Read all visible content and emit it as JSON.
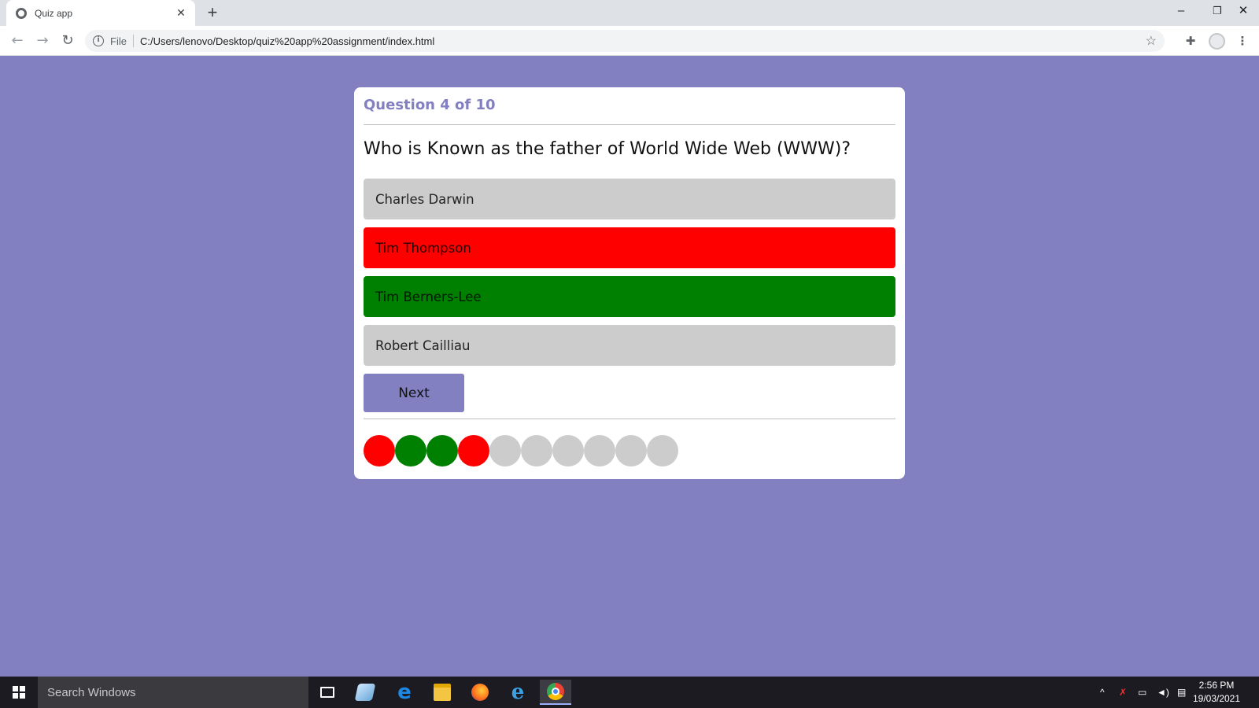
{
  "browser": {
    "tab_title": "Quiz app",
    "tab_close": "✕",
    "new_tab": "+",
    "scheme_label": "File",
    "url": "C:/Users/lenovo/Desktop/quiz%20app%20assignment/index.html",
    "window_controls": {
      "minimize": "–",
      "restore": "❐",
      "close": "✕"
    }
  },
  "quiz": {
    "progress_text": "Question 4 of 10",
    "question": "Who is Known as the father of World Wide Web (WWW)?",
    "options": [
      {
        "label": "Charles Darwin",
        "state": "default"
      },
      {
        "label": "Tim Thompson",
        "state": "wrong"
      },
      {
        "label": "Tim Berners-Lee",
        "state": "correct"
      },
      {
        "label": "Robert Cailliau",
        "state": "default"
      }
    ],
    "next_label": "Next",
    "answer_history": [
      "wrong",
      "correct",
      "correct",
      "wrong",
      "unanswered",
      "unanswered",
      "unanswered",
      "unanswered",
      "unanswered",
      "unanswered"
    ]
  },
  "colors": {
    "page_background": "#8380c1",
    "accent": "#8380c1",
    "wrong": "#ff0000",
    "correct": "#008000",
    "neutral": "#cccccc"
  },
  "taskbar": {
    "search_placeholder": "Search Windows",
    "apps": [
      "task-view-icon",
      "notepad-icon",
      "edge-icon",
      "file-explorer-icon",
      "firefox-icon",
      "internet-explorer-icon",
      "chrome-icon"
    ],
    "time": "2:56 PM",
    "date": "19/03/2021"
  }
}
